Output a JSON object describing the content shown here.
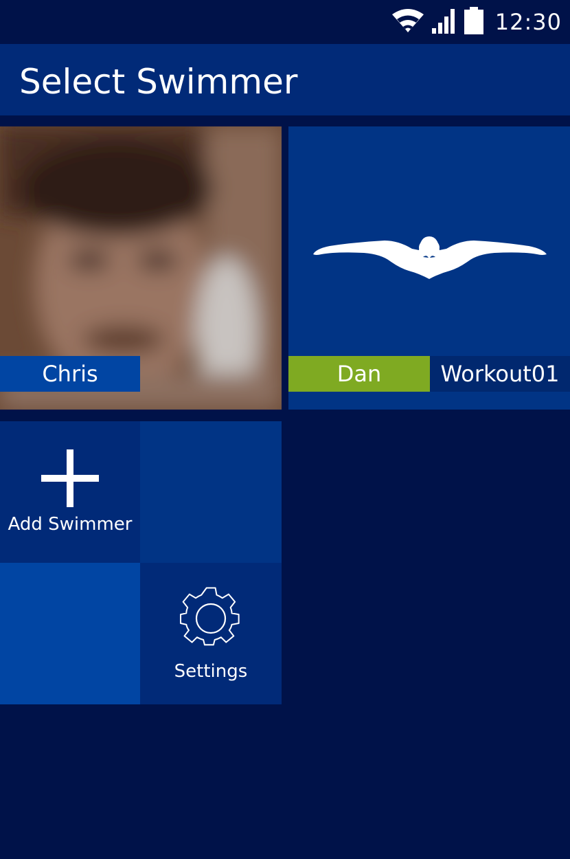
{
  "status_bar": {
    "time": "12:30",
    "icons": [
      "wifi-icon",
      "signal-icon",
      "battery-icon"
    ]
  },
  "app_bar": {
    "title": "Select Swimmer"
  },
  "swimmers": [
    {
      "name": "Chris",
      "image": "profile-photo"
    },
    {
      "name": "Dan",
      "image": "swimmer-icon",
      "workout": "Workout01"
    }
  ],
  "actions": {
    "add_label": "Add Swimmer",
    "settings_label": "Settings"
  },
  "colors": {
    "background": "#001249",
    "app_bar": "#012a78",
    "tile_blue": "#013485",
    "tile_light": "#0145a3",
    "accent_green": "#7faa22"
  }
}
